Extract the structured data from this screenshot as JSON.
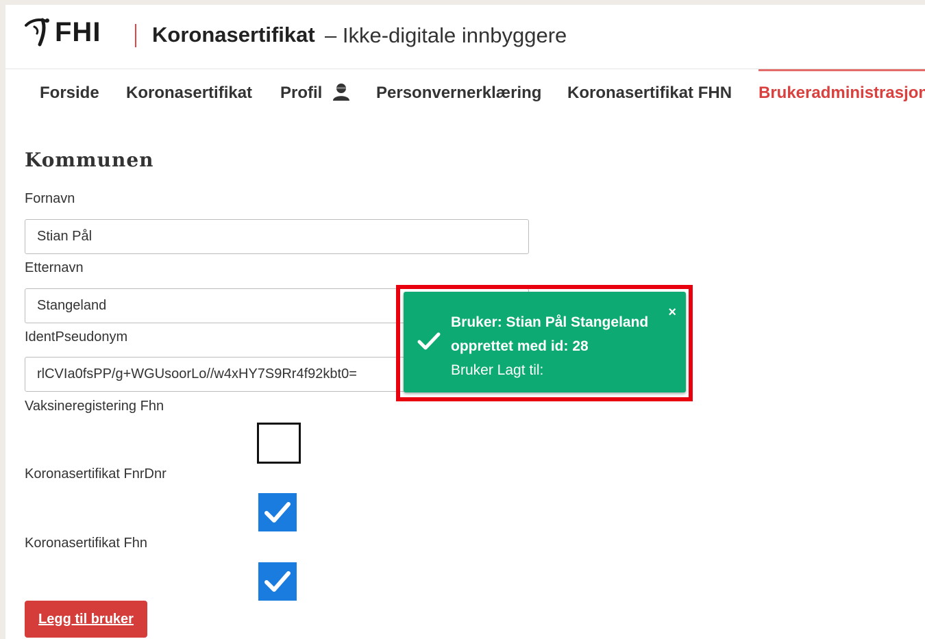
{
  "header": {
    "logo_text": "FHI",
    "app_title": "Koronasertifikat",
    "app_subtitle": "– Ikke-digitale innbyggere"
  },
  "nav": {
    "items": [
      {
        "label": "Forside"
      },
      {
        "label": "Koronasertifikat"
      },
      {
        "label": "Profil"
      },
      {
        "label": "Personvernerklæring"
      },
      {
        "label": "Koronasertifikat FHN"
      },
      {
        "label": "Brukeradministrasjon"
      }
    ],
    "active_index": 5
  },
  "form": {
    "section_title": "Kommunen",
    "fornavn_label": "Fornavn",
    "fornavn_value": "Stian Pål",
    "etternavn_label": "Etternavn",
    "etternavn_value": "Stangeland",
    "ident_label": "IdentPseudonym",
    "ident_value": "rlCVIa0fsPP/g+WGUsoorLo//w4xHY7S9Rr4f92kbt0=",
    "vaksine_label": "Vaksineregistering Fhn",
    "vaksine_checked": false,
    "fnrdnr_label": "Koronasertifikat FnrDnr",
    "fnrdnr_checked": true,
    "fhn_label": "Koronasertifikat Fhn",
    "fhn_checked": true,
    "submit_label": "Legg til bruker"
  },
  "toast": {
    "line1": "Bruker: Stian Pål Stangeland",
    "line2": "opprettet med id: 28",
    "line3": "Bruker Lagt til:",
    "close_symbol": "×"
  },
  "colors": {
    "accent_red": "#d53d3b",
    "active_nav": "#d9413f",
    "toast_green": "#0eaa73",
    "checkbox_blue": "#1b7ce0",
    "highlight_red": "#e8000e"
  }
}
